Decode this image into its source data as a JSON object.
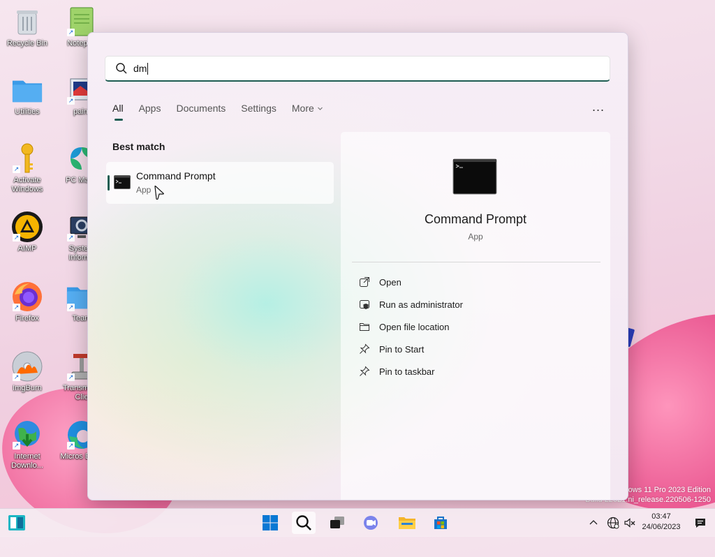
{
  "desktop": {
    "icons": [
      {
        "label": "Recycle Bin"
      },
      {
        "label": "Notepad"
      },
      {
        "label": "Utilities"
      },
      {
        "label": "paint"
      },
      {
        "label": "Activate Windows"
      },
      {
        "label": "PC Mana"
      },
      {
        "label": "AIMP"
      },
      {
        "label": "System Informa"
      },
      {
        "label": "Firefox"
      },
      {
        "label": "Team"
      },
      {
        "label": "ImgBurn"
      },
      {
        "label": "Transmi Qt Clie"
      },
      {
        "label": "Internet Downlo..."
      },
      {
        "label": "Micros Edge"
      }
    ],
    "watermark_line1": "ows 11 Pro 2023 Edition",
    "watermark_line2": "Build 22621.ni_release.220506-1250"
  },
  "search": {
    "value": "dm",
    "tabs": [
      {
        "label": "All"
      },
      {
        "label": "Apps"
      },
      {
        "label": "Documents"
      },
      {
        "label": "Settings"
      },
      {
        "label": "More"
      }
    ],
    "more_options": "..."
  },
  "best_match": {
    "heading": "Best match",
    "name": "Command Prompt",
    "type": "App"
  },
  "detail": {
    "name": "Command Prompt",
    "type": "App",
    "actions": [
      {
        "label": "Open",
        "icon": "open-external-icon"
      },
      {
        "label": "Run as administrator",
        "icon": "shield-admin-icon"
      },
      {
        "label": "Open file location",
        "icon": "folder-icon"
      },
      {
        "label": "Pin to Start",
        "icon": "pin-icon"
      },
      {
        "label": "Pin to taskbar",
        "icon": "pin-icon"
      }
    ]
  },
  "taskbar": {
    "time": "03:47",
    "date": "24/06/2023"
  },
  "colors": {
    "accent": "#1e5d52",
    "start_blue": "#0a78d4"
  }
}
